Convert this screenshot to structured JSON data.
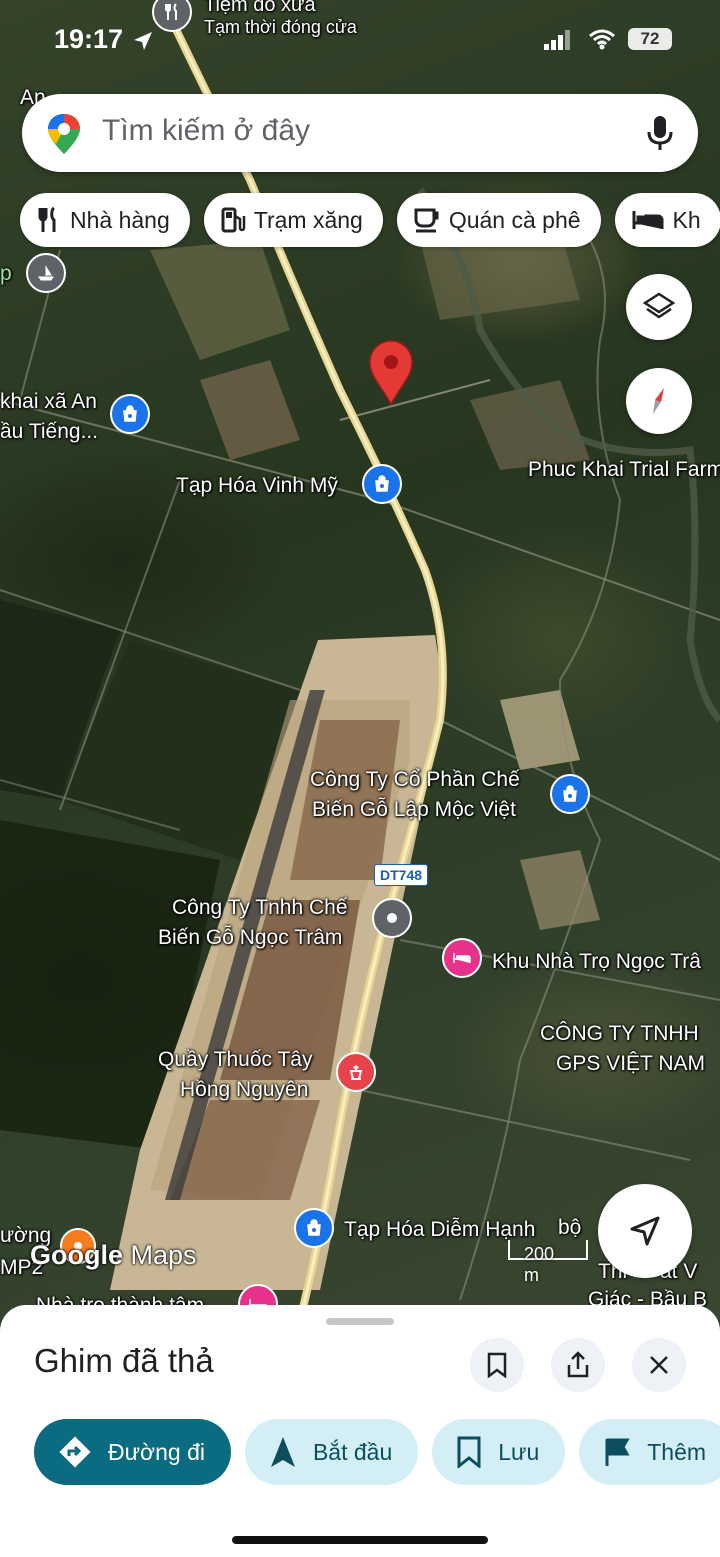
{
  "status_bar": {
    "time": "19:17",
    "battery": "72"
  },
  "search": {
    "placeholder": "Tìm kiếm ở đây",
    "logo_icon": "google-maps-pin-icon",
    "mic_icon": "mic-icon"
  },
  "chips": [
    {
      "label": "Nhà hàng",
      "icon": "restaurant-icon"
    },
    {
      "label": "Trạm xăng",
      "icon": "gas-station-icon"
    },
    {
      "label": "Quán cà phê",
      "icon": "coffee-icon"
    },
    {
      "label": "Kh",
      "icon": "hotel-icon"
    }
  ],
  "map": {
    "top_label": "Tiệm đồ xưa",
    "top_sublabel": "Tạm thời đóng cửa",
    "top_left_partial": "An",
    "left_partial": "p",
    "road_shield": "DT748",
    "google_logo": "Google",
    "google_logo_suffix": "Maps",
    "scale_label": "200 m",
    "pois": [
      {
        "line1": "khai xã An",
        "line2": "ầu Tiếng...",
        "type": "shopping",
        "color": "#1a73e8"
      },
      {
        "line1": "Tạp Hóa Vinh Mỹ",
        "line2": "",
        "type": "shopping",
        "color": "#1a73e8"
      },
      {
        "line1": "Phuc Khai Trial Farm",
        "line2": "",
        "type": "label",
        "color": ""
      },
      {
        "line1": "Công Ty Cổ Phần Chế",
        "line2": "Biến Gỗ Lập Mộc Việt",
        "type": "shopping",
        "color": "#1a73e8"
      },
      {
        "line1": "Công Ty Tnhh Chế",
        "line2": "Biến Gỗ Ngọc Trâm",
        "type": "generic",
        "color": "#5f6368"
      },
      {
        "line1": "Khu Nhà Trọ Ngọc Trâ",
        "line2": "",
        "type": "lodging",
        "color": "#e8318a"
      },
      {
        "line1": "CÔNG TY TNHH",
        "line2": "GPS VIỆT NAM",
        "type": "label",
        "color": ""
      },
      {
        "line1": "Quầy Thuốc Tây",
        "line2": "Hồng Nguyên",
        "type": "pharmacy",
        "color": "#e8434a"
      },
      {
        "line1": "Tạp Hóa Diễm Hạnh",
        "line2": "",
        "type": "shopping",
        "color": "#1a73e8"
      },
      {
        "line1": "ường",
        "line2": "MP2",
        "type": "label",
        "color": ""
      },
      {
        "line1": "Nhà trọ thành tâm",
        "line2": "",
        "type": "label",
        "color": ""
      },
      {
        "line1": "Thi",
        "line2": "Giác - Bầu B",
        "type": "label",
        "color": ""
      },
      {
        "line1": "bộ",
        "line2": "",
        "type": "label",
        "color": ""
      },
      {
        "line1": "ất V",
        "line2": "",
        "type": "label",
        "color": ""
      }
    ]
  },
  "sheet": {
    "title": "Ghim đã thả",
    "save_icon": "bookmark-icon",
    "share_icon": "share-icon",
    "close_icon": "close-icon",
    "buttons": [
      {
        "label": "Đường đi",
        "icon": "directions-icon"
      },
      {
        "label": "Bắt đầu",
        "icon": "navigation-arrow-icon"
      },
      {
        "label": "Lưu",
        "icon": "bookmark-icon"
      },
      {
        "label": "Thêm",
        "icon": "flag-icon"
      }
    ]
  },
  "colors": {
    "pin_red": "#e53935",
    "primary_teal": "#0b6b80",
    "pill_bg": "#d3eef5",
    "road_yellow": "#f0dfa2"
  }
}
